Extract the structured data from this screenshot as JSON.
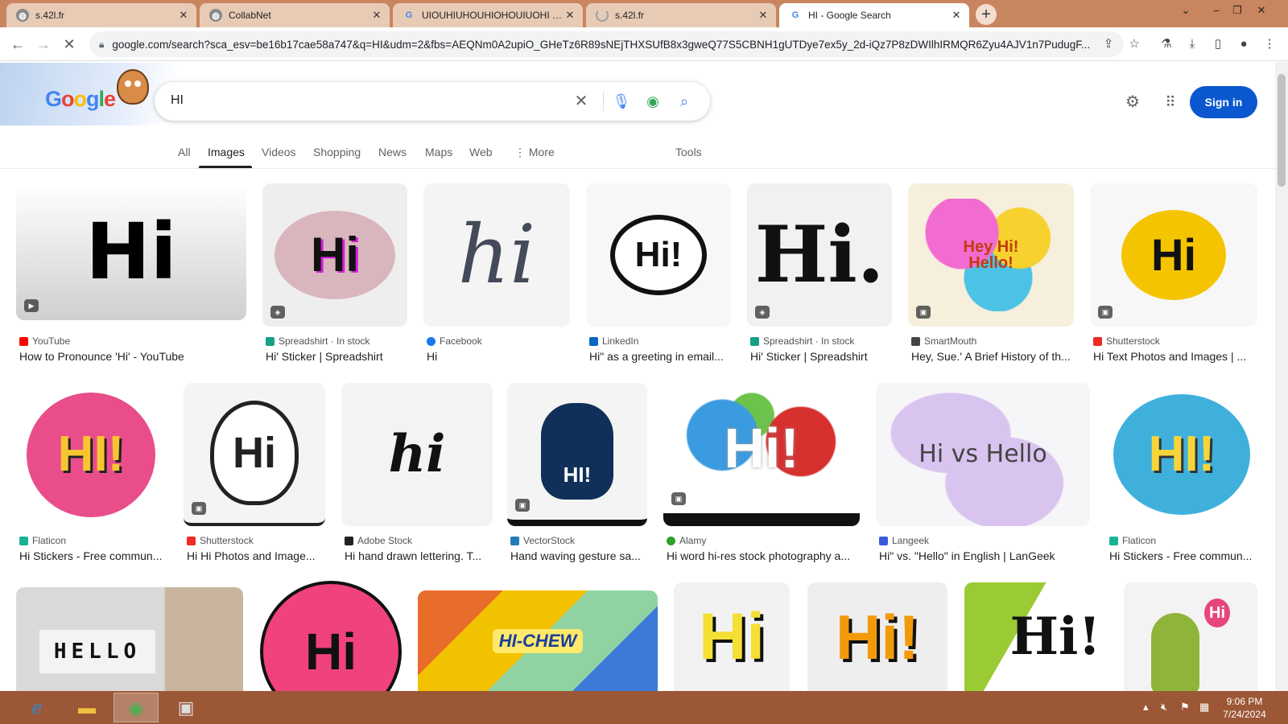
{
  "browser": {
    "tabs": [
      {
        "title": "s.42l.fr",
        "favicon": "globe-icon",
        "active": false
      },
      {
        "title": "CollabNet",
        "favicon": "globe-icon",
        "active": false
      },
      {
        "title": "UIOUHIUHOUHIOHOUIUOHI - G",
        "favicon": "google-icon",
        "active": false
      },
      {
        "title": "s.42l.fr",
        "favicon": "loading-icon",
        "active": false
      },
      {
        "title": "HI - Google Search",
        "favicon": "google-icon",
        "active": true
      }
    ],
    "url": "google.com/search?sca_esv=be16b17cae58a747&q=HI&udm=2&fbs=AEQNm0A2upiO_GHeTz6R89sNEjTHXSUfB8x3gweQ77S5CBNH1gUTDye7ex5y_2d-iQz7P8zDWIlhIRMQR6Zyu4AJV1n7PudugF..."
  },
  "search": {
    "query": "HI",
    "sign_in": "Sign in",
    "filters": [
      "All",
      "Images",
      "Videos",
      "Shopping",
      "News",
      "Maps",
      "Web",
      "More"
    ],
    "active_filter": "Images",
    "tools": "Tools"
  },
  "results": [
    {
      "source": "YouTube",
      "title": "How to Pronounce 'Hi' - YouTube",
      "thumb_text": "Hi",
      "source_color": "#ff0000"
    },
    {
      "source": "Spreadshirt · In stock",
      "title": "Hi' Sticker | Spreadshirt",
      "thumb_text": "Hi",
      "source_color": "#16a085"
    },
    {
      "source": "Facebook",
      "title": "Hi",
      "thumb_text": "hi",
      "source_color": "#1877f2"
    },
    {
      "source": "LinkedIn",
      "title": "Hi\" as a greeting in email...",
      "thumb_text": "Hi!",
      "source_color": "#0a66c2"
    },
    {
      "source": "Spreadshirt · In stock",
      "title": "Hi' Sticker | Spreadshirt",
      "thumb_text": "Hi.",
      "source_color": "#16a085"
    },
    {
      "source": "SmartMouth",
      "title": "Hey, Sue.' A Brief History of th...",
      "thumb_text": "Hey Hi! Hello!",
      "source_color": "#444444"
    },
    {
      "source": "Shutterstock",
      "title": "Hi Text Photos and Images | ...",
      "thumb_text": "Hi",
      "source_color": "#ee2b24"
    },
    {
      "source": "Flaticon",
      "title": "Hi Stickers - Free commun...",
      "thumb_text": "HI!",
      "source_color": "#19b394"
    },
    {
      "source": "Shutterstock",
      "title": "Hi Hi Photos and Image...",
      "thumb_text": "Hi",
      "source_color": "#ee2b24"
    },
    {
      "source": "Adobe Stock",
      "title": "Hi hand drawn lettering. T...",
      "thumb_text": "hi",
      "source_color": "#222222"
    },
    {
      "source": "VectorStock",
      "title": "Hand waving gesture sa...",
      "thumb_text": "HI!",
      "source_color": "#1f7fb5"
    },
    {
      "source": "Alamy",
      "title": "Hi word hi-res stock photography a...",
      "thumb_text": "Hi!",
      "source_color": "#2ca12c"
    },
    {
      "source": "Langeek",
      "title": "Hi\" vs. \"Hello\" in English | LanGeek",
      "thumb_text": "Hi vs Hello",
      "source_color": "#3b5bdb"
    },
    {
      "source": "Flaticon",
      "title": "Hi Stickers - Free commun...",
      "thumb_text": "HI!",
      "source_color": "#19b394"
    },
    {
      "source": "",
      "title": "",
      "thumb_text": "HELLO",
      "source_color": ""
    },
    {
      "source": "",
      "title": "",
      "thumb_text": "Hi",
      "source_color": ""
    },
    {
      "source": "",
      "title": "",
      "thumb_text": "HI-CHEW",
      "source_color": ""
    },
    {
      "source": "",
      "title": "",
      "thumb_text": "Hi",
      "source_color": ""
    },
    {
      "source": "",
      "title": "",
      "thumb_text": "Hi!",
      "source_color": ""
    },
    {
      "source": "",
      "title": "",
      "thumb_text": "Hi!",
      "source_color": ""
    },
    {
      "source": "",
      "title": "",
      "thumb_text": "Hi",
      "source_color": ""
    }
  ],
  "taskbar": {
    "time": "9:06 PM",
    "date": "7/24/2024"
  }
}
